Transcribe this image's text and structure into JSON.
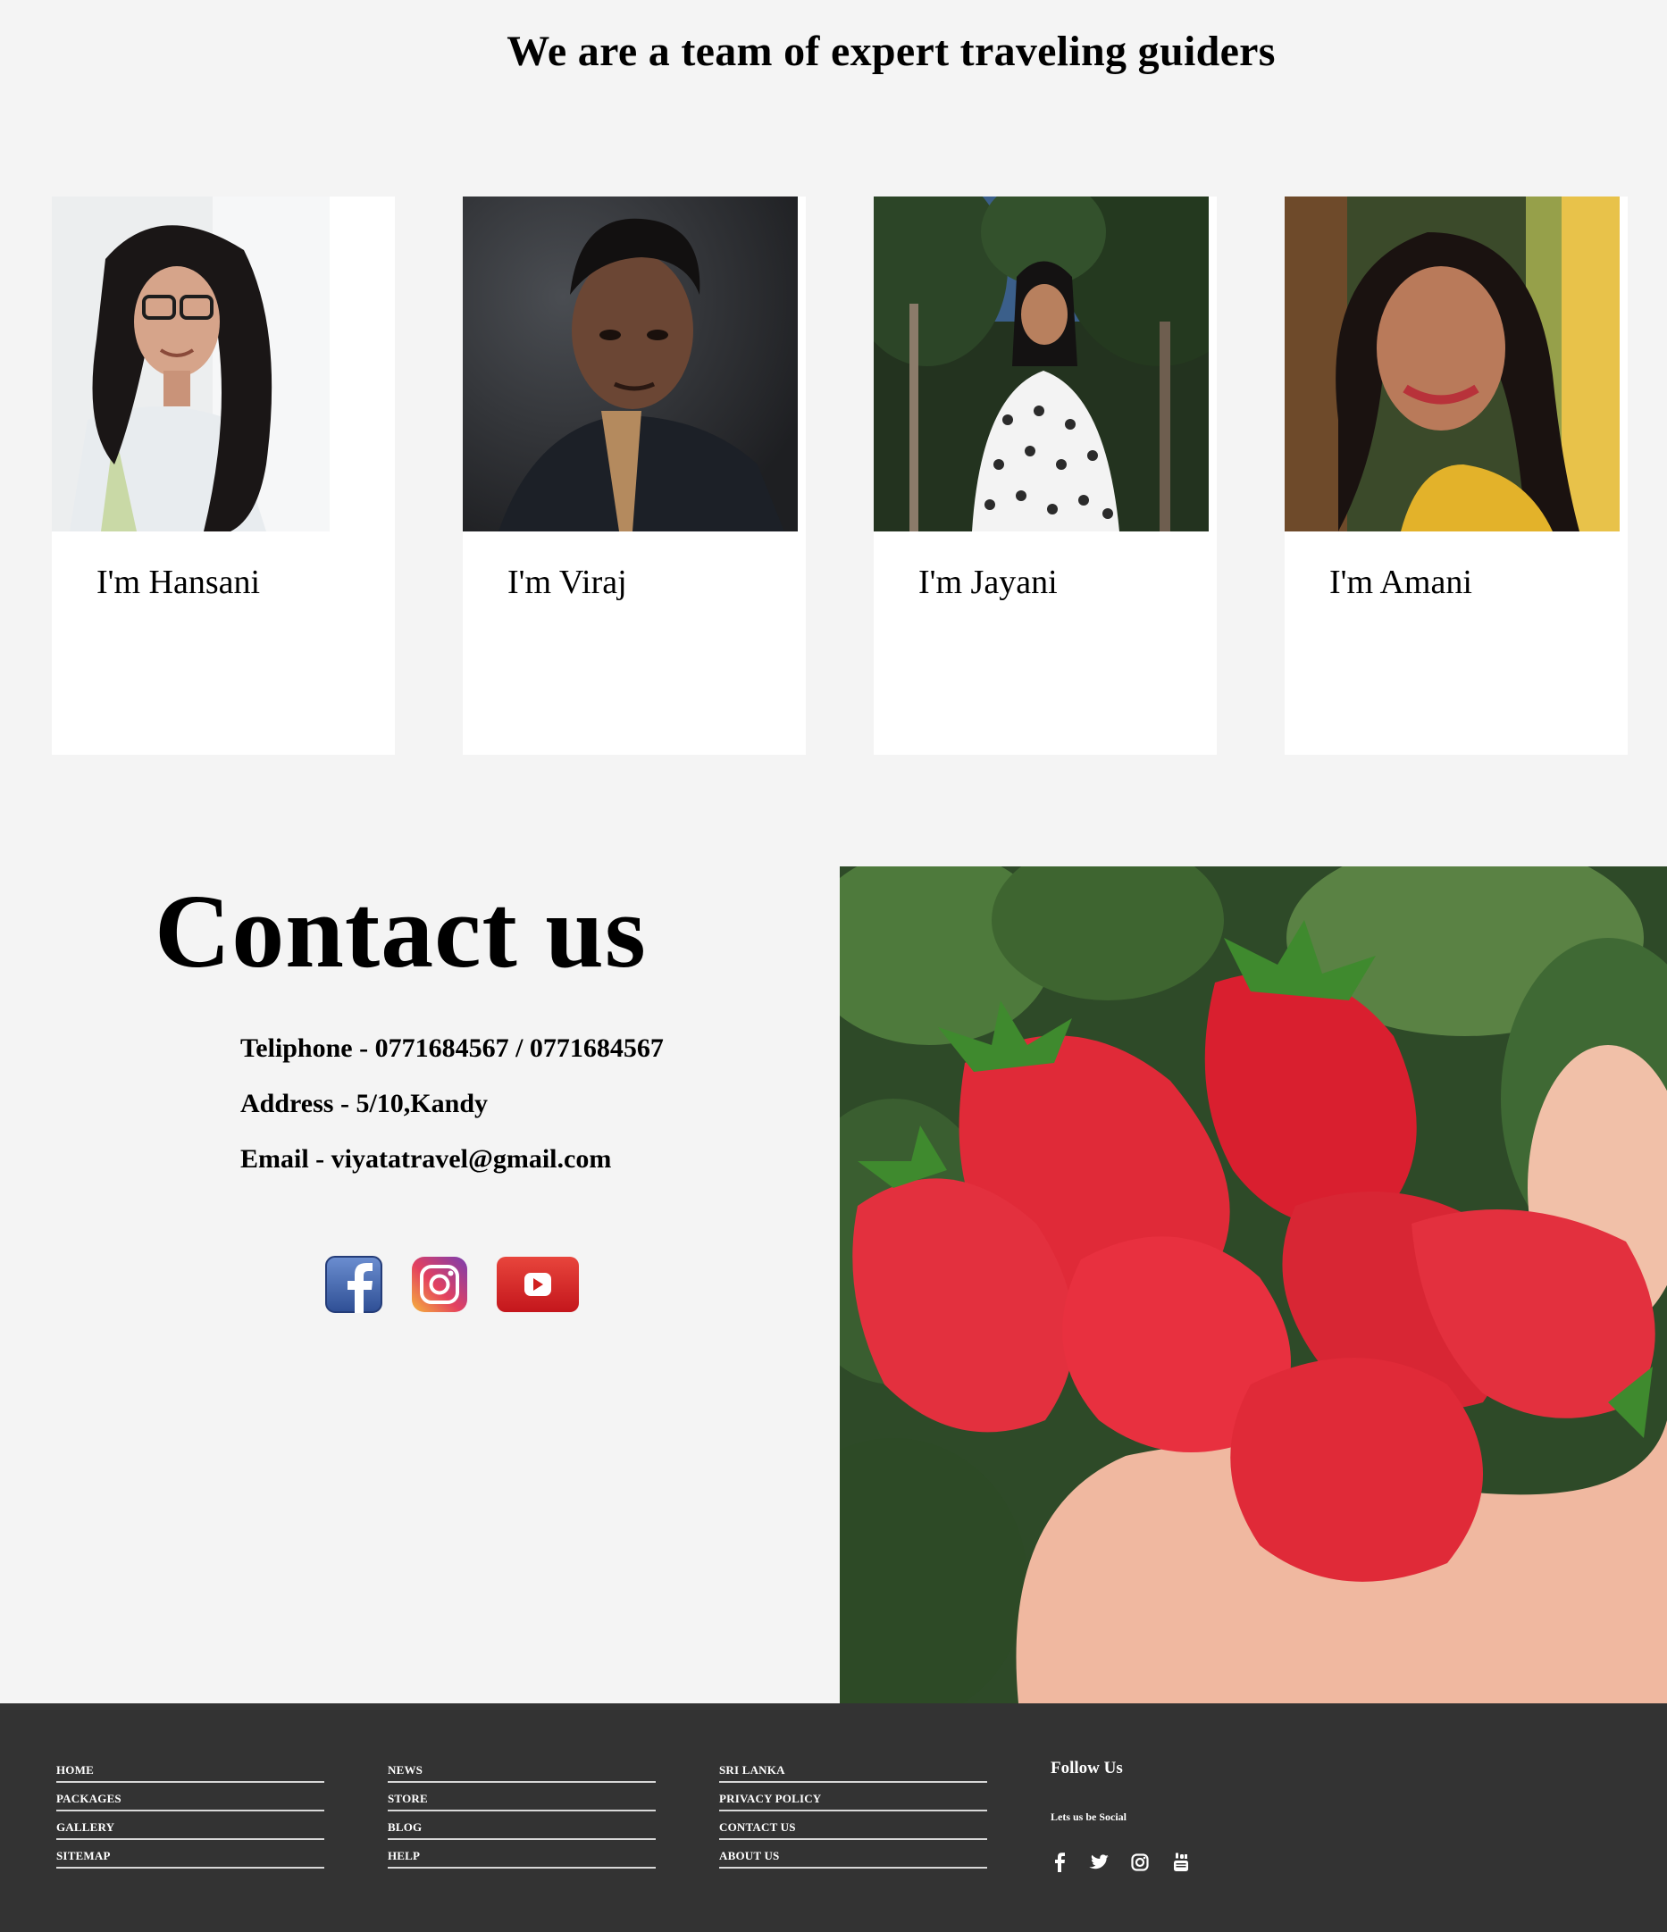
{
  "team": {
    "heading": "We are a team of expert traveling guiders",
    "members": [
      {
        "name": "I'm Hansani"
      },
      {
        "name": "I'm Viraj"
      },
      {
        "name": "I'm Jayani"
      },
      {
        "name": "I'm Amani"
      }
    ]
  },
  "contact": {
    "title": "Contact us",
    "telephone": "Teliphone - 0771684567 / 0771684567",
    "address": "Address - 5/10,Kandy",
    "email": "Email - viyatatravel@gmail.com",
    "social_icons": [
      "facebook-icon",
      "instagram-icon",
      "youtube-icon"
    ]
  },
  "footer": {
    "columns": [
      [
        "HOME",
        "PACKAGES",
        "GALLERY",
        "SITEMAP"
      ],
      [
        "NEWS",
        "STORE",
        "BLOG",
        "HELP"
      ],
      [
        "SRI LANKA",
        "PRIVACY POLICY",
        "CONTACT US",
        "ABOUT US"
      ]
    ],
    "follow_title": "Follow Us",
    "follow_sub": "Lets us be Social",
    "social_icons": [
      "facebook-icon",
      "twitter-icon",
      "instagram-icon",
      "youtube-icon"
    ],
    "background": "#333333"
  }
}
